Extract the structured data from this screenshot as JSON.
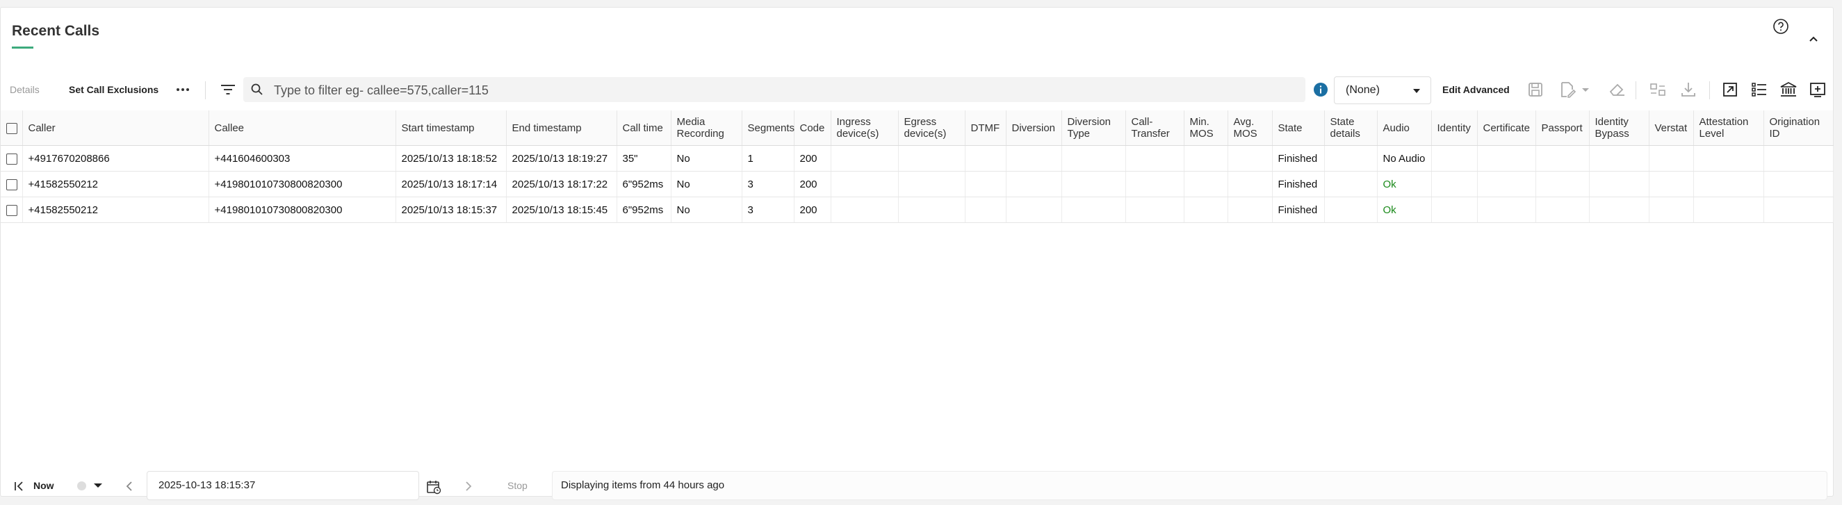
{
  "header": {
    "title": "Recent Calls"
  },
  "toolbar": {
    "details_label": "Details",
    "exclusions_label": "Set Call Exclusions",
    "more_icon": "more-horizontal-icon",
    "search_placeholder": "Type to filter eg- callee=575,caller=115",
    "search_value": "",
    "select_value": "(None)",
    "edit_advanced_label": "Edit Advanced",
    "icons": [
      "save-icon",
      "export-edit-icon",
      "eraser-icon",
      "compare-icon",
      "download-icon",
      "open-external-icon",
      "list-icon",
      "bank-icon",
      "add-panel-icon"
    ]
  },
  "table": {
    "columns": [
      "Caller",
      "Callee",
      "Start timestamp",
      "End timestamp",
      "Call time",
      "Media Recording",
      "Segments",
      "Code",
      "Ingress device(s)",
      "Egress device(s)",
      "DTMF",
      "Diversion",
      "Diversion Type",
      "Call-Transfer",
      "Min. MOS",
      "Avg. MOS",
      "State",
      "State details",
      "Audio",
      "Identity",
      "Certificate",
      "Passport",
      "Identity Bypass",
      "Verstat",
      "Attestation Level",
      "Origination ID"
    ],
    "rows": [
      [
        "+4917670208866",
        "+441604600303",
        "2025/10/13 18:18:52",
        "2025/10/13 18:19:27",
        "35\"",
        "No",
        "1",
        "200",
        "",
        "",
        "",
        "",
        "",
        "",
        "",
        "",
        "Finished",
        "",
        "No Audio",
        "",
        "",
        "",
        "",
        "",
        "",
        ""
      ],
      [
        "+41582550212",
        "+41980101073080082030​0",
        "2025/10/13 18:17:14",
        "2025/10/13 18:17:22",
        "6\"952ms",
        "No",
        "3",
        "200",
        "",
        "",
        "",
        "",
        "",
        "",
        "",
        "",
        "Finished",
        "",
        "Ok",
        "",
        "",
        "",
        "",
        "",
        "",
        ""
      ],
      [
        "+41582550212",
        "+419801010730800820300",
        "2025/10/13 18:15:37",
        "2025/10/13 18:15:45",
        "6\"952ms",
        "No",
        "3",
        "200",
        "",
        "",
        "",
        "",
        "",
        "",
        "",
        "",
        "Finished",
        "",
        "Ok",
        "",
        "",
        "",
        "",
        "",
        "",
        ""
      ]
    ]
  },
  "footer": {
    "now_label": "Now",
    "date_value": "2025-10-13 18:15:37",
    "stop_label": "Stop",
    "status_text": "Displaying items from 44 hours ago"
  },
  "colors": {
    "accent": "#3daa7d",
    "ok": "#1a8a1a",
    "info": "#1b6fa3"
  }
}
